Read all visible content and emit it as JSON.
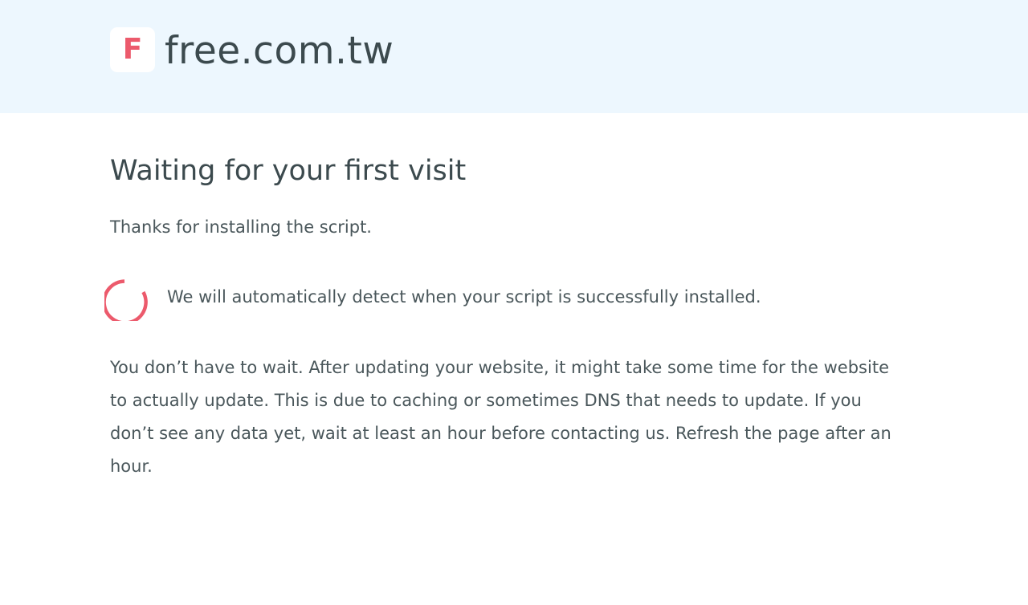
{
  "header": {
    "logo_letter": "F",
    "site_name": "free.com.tw",
    "background_color": "#edf7fe",
    "accent_color": "#ec5a6c"
  },
  "main": {
    "title": "Waiting for your first visit",
    "thanks_text": "Thanks for installing the script.",
    "spinner_icon": "loading-spinner-icon",
    "detect_text": "We will automatically detect when your script is successfully installed.",
    "wait_text": "You don’t have to wait. After updating your website, it might take some time for the website to actually update. This is due to caching or sometimes DNS that needs to update. If you don’t see any data yet, wait at least an hour before contacting us. Refresh the page after an hour."
  }
}
